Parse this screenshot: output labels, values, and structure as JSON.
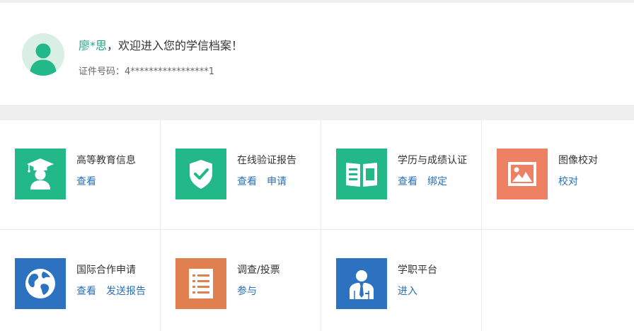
{
  "profile": {
    "username": "廖*思",
    "welcome_suffix": "，欢迎进入您的学信档案！",
    "id_label": "证件号码：",
    "id_value": "4*****************1"
  },
  "colors": {
    "green": "#22b887",
    "salmon": "#ee8064",
    "blue": "#2c72c0",
    "orange": "#e08050",
    "link": "#2a6fb8",
    "name": "#22a585"
  },
  "services": [
    {
      "title": "高等教育信息",
      "icon": "graduate-icon",
      "links": [
        "查看"
      ]
    },
    {
      "title": "在线验证报告",
      "icon": "shield-check-icon",
      "links": [
        "查看",
        "申请"
      ]
    },
    {
      "title": "学历与成绩认证",
      "icon": "open-book-icon",
      "links": [
        "查看",
        "绑定"
      ]
    },
    {
      "title": "图像校对",
      "icon": "picture-icon",
      "links": [
        "校对"
      ]
    },
    {
      "title": "国际合作申请",
      "icon": "globe-icon",
      "links": [
        "查看",
        "发送报告"
      ]
    },
    {
      "title": "调查/投票",
      "icon": "list-icon",
      "links": [
        "参与"
      ]
    },
    {
      "title": "学职平台",
      "icon": "business-person-icon",
      "links": [
        "进入"
      ]
    }
  ]
}
